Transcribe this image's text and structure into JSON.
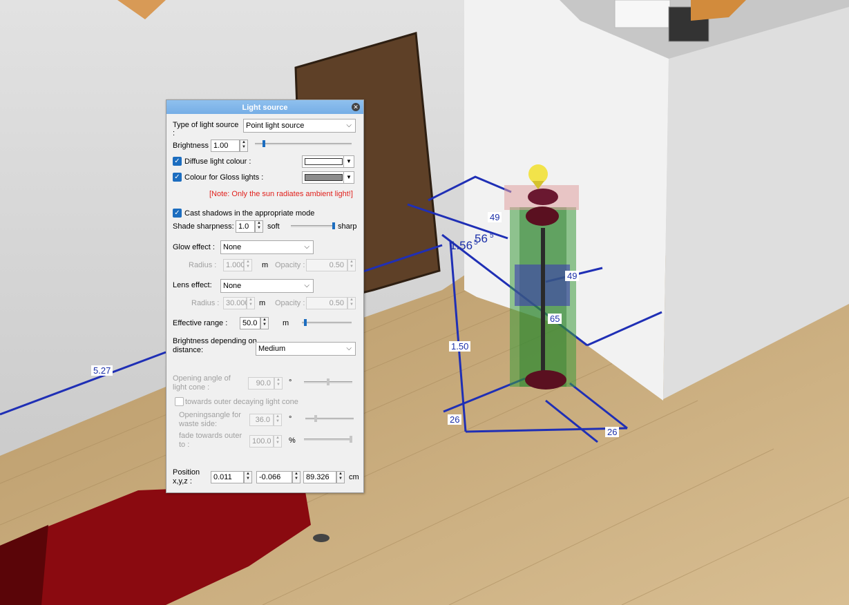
{
  "scene": {
    "dimensions": [
      "5.27",
      "49",
      "1.56",
      "56",
      "5",
      "5",
      "49",
      "65",
      "1.50",
      "26",
      "26"
    ],
    "colors": {
      "dimension_line": "#1f2fb5",
      "wall": "#d9d9d9",
      "floor": "#c9a977",
      "door": "#5a3c23",
      "sofa": "#8e0c12"
    }
  },
  "dialog": {
    "title": "Light source",
    "type_label": "Type of light source :",
    "type_value": "Point light source",
    "brightness_label": "Brightness :",
    "brightness_value": "1.00",
    "brightness_level": 0.08,
    "diffuse_label": "Diffuse light colour :",
    "diffuse_color": "#ffffff",
    "gloss_label": "Colour for Gloss lights :",
    "gloss_color": "#8c8c8c",
    "note": "[Note: Only the sun radiates ambient light!]",
    "cast_shadows_label": "Cast shadows in the appropriate mode",
    "shade_sharpness_label": "Shade sharpness:",
    "shade_sharpness_value": "1.0",
    "soft_label": "soft",
    "sharp_label": "sharp",
    "shade_sharpness_level": 1.0,
    "glow_label": "Glow effect :",
    "glow_value": "None",
    "glow_radius_label": "Radius :",
    "glow_radius_value": "1.000",
    "glow_radius_unit": "m",
    "glow_opacity_label": "Opacity :",
    "glow_opacity_value": "0.50",
    "lens_label": "Lens effect:",
    "lens_value": "None",
    "lens_radius_label": "Radius :",
    "lens_radius_value": "30.000",
    "lens_radius_unit": "m",
    "lens_opacity_label": "Opacity :",
    "lens_opacity_value": "0.50",
    "effective_range_label": "Effective range :",
    "effective_range_value": "50.0",
    "effective_range_unit": "m",
    "effective_range_level": 0.05,
    "brightness_distance_label": "Brightness depending on distance:",
    "brightness_distance_value": "Medium",
    "opening_angle_label": "Opening angle of light cone :",
    "opening_angle_value": "90.0",
    "opening_angle_unit": "°",
    "opening_angle_level": 0.5,
    "outer_decay_label": "towards outer decaying light cone",
    "waste_angle_label": "Openingsangle for waste side:",
    "waste_angle_value": "36.0",
    "waste_angle_unit": "°",
    "waste_angle_level": 0.2,
    "fade_label": "fade towards outer to :",
    "fade_value": "100.0",
    "fade_unit": "%",
    "fade_level": 1.0,
    "position_label": "Position x,y,z :",
    "pos_x": "0.011",
    "pos_y": "-0.066",
    "pos_z": "89.326",
    "position_unit": "cm",
    "accent_color": "#1c6dbf",
    "note_color": "#e0201c"
  }
}
